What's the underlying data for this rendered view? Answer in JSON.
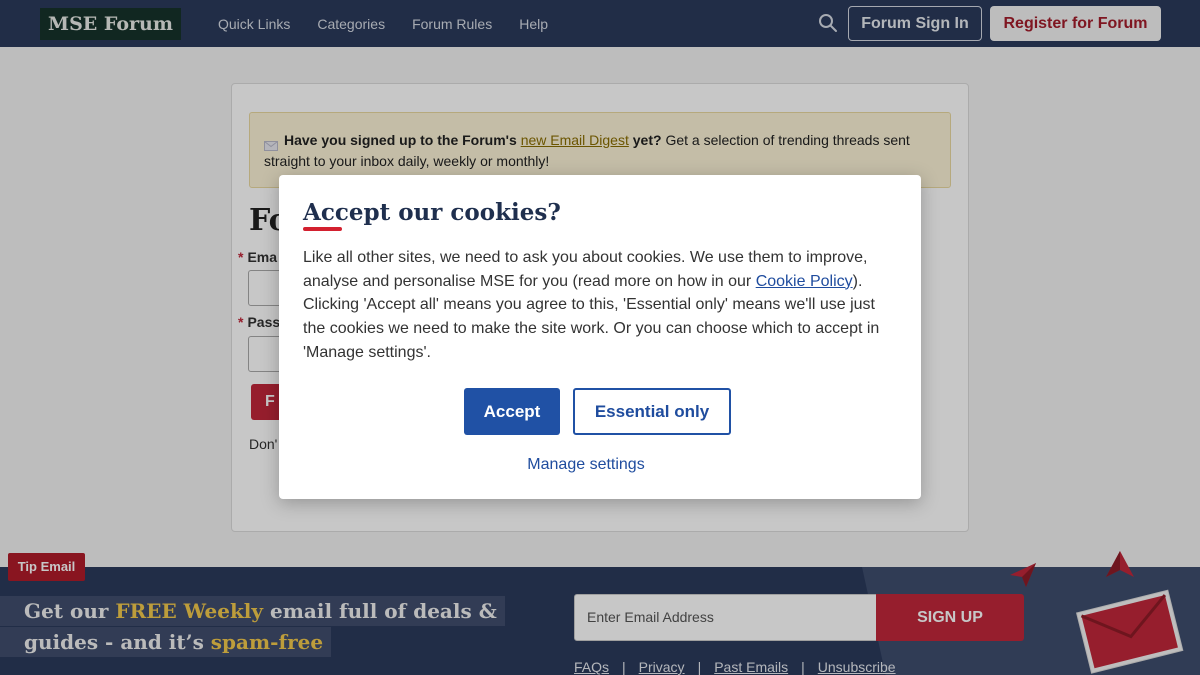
{
  "header": {
    "logo": "MSE Forum",
    "nav": [
      "Quick Links",
      "Categories",
      "Forum Rules",
      "Help"
    ],
    "search_icon": "search-icon",
    "sign_in": "Forum Sign In",
    "register": "Register for Forum"
  },
  "page": {
    "notice": {
      "icon": "envelope-icon",
      "lead": "Have you signed up to the Forum's",
      "link": "new Email Digest",
      "tail_bold": "yet?",
      "rest": "Get a selection of trending threads sent straight to your inbox daily, weekly or monthly!"
    },
    "heading": "Fo",
    "email_label": "Ema",
    "password_label": "Pass",
    "button_label": "F",
    "small_text": "Don'"
  },
  "cookie_modal": {
    "title": "Accept our cookies?",
    "body_before_link": "Like all other sites, we need to ask you about cookies. We use them to improve, analyse and personalise MSE for you (read more on how in our ",
    "link": "Cookie Policy",
    "body_after_link": "). Clicking 'Accept all' means you agree to this, 'Essential only' means we'll use just the cookies we need to make the site work. Or you can choose which to accept in 'Manage settings'.",
    "accept": "Accept",
    "essential": "Essential only",
    "manage": "Manage settings"
  },
  "footer": {
    "badge": "Tip Email",
    "line1": {
      "a": "Get our ",
      "hl": "FREE Weekly",
      "b": " email full of deals &"
    },
    "line2": {
      "a": "guides - and it’s ",
      "hl": "spam-free"
    },
    "email_placeholder": "Enter Email Address",
    "signup": "SIGN UP",
    "links": [
      "FAQs",
      "Privacy",
      "Past Emails",
      "Unsubscribe"
    ],
    "separator": "|",
    "decor_icons": [
      "paper-plane-icon",
      "paper-plane-icon",
      "envelope-icon"
    ]
  },
  "colors": {
    "header_bg": "#2b3a5c",
    "brand_red": "#c0273a",
    "button_blue": "#2051a5",
    "highlight_yellow": "#f2c94c"
  }
}
